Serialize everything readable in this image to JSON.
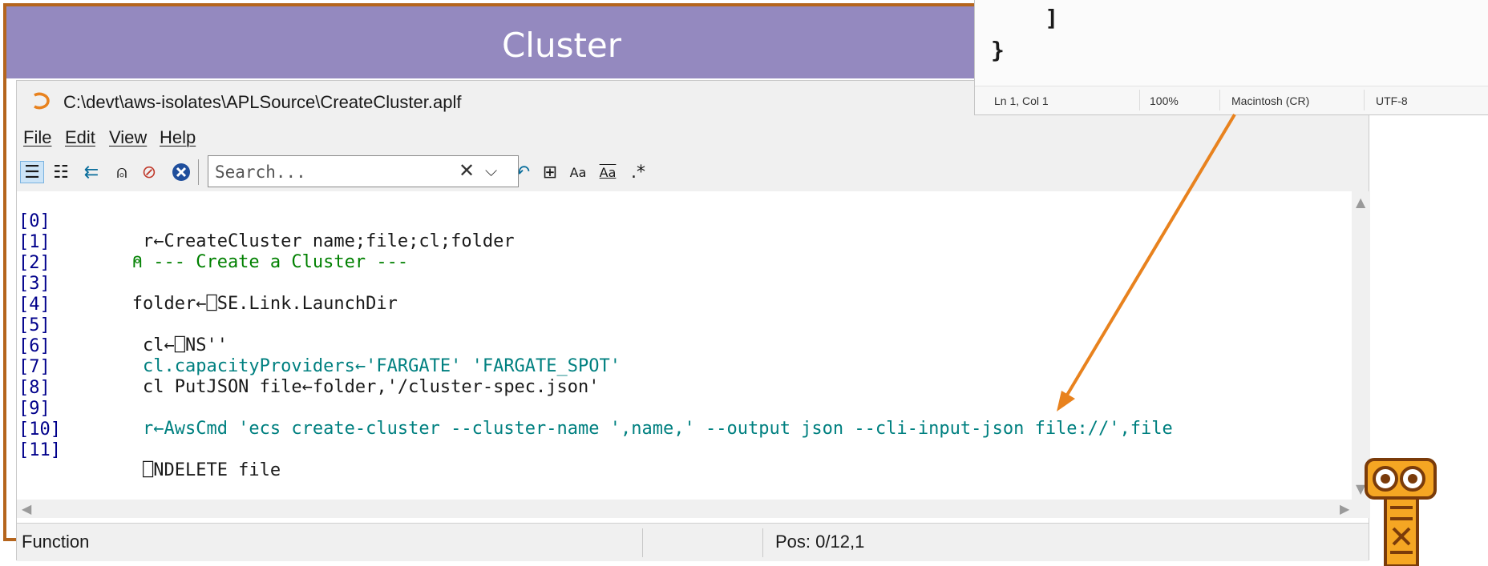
{
  "slide": {
    "title": "Cluster"
  },
  "window": {
    "title": "C:\\devt\\aws-isolates\\APLSource\\CreateCluster.aplf",
    "menu": [
      "File",
      "Edit",
      "View",
      "Help"
    ],
    "search_placeholder": "Search...",
    "clear_symbol": "✕",
    "dropdown_symbol": "⌵"
  },
  "code_lines": [
    {
      "num": "[0]",
      "text": "    r←CreateCluster name;file;cl;folder"
    },
    {
      "num": "[1]",
      "text": "   ⍝ --- Create a Cluster ---"
    },
    {
      "num": "[2]",
      "text": ""
    },
    {
      "num": "[3]",
      "text": "   folder←⎕SE.Link.LaunchDir"
    },
    {
      "num": "[4]",
      "text": ""
    },
    {
      "num": "[5]",
      "text": "    cl←⎕NS''"
    },
    {
      "num": "[6]",
      "text": "    cl.capacityProviders←'FARGATE' 'FARGATE_SPOT'"
    },
    {
      "num": "[7]",
      "text": "    cl PutJSON file←folder,'/cluster-spec.json'"
    },
    {
      "num": "[8]",
      "text": ""
    },
    {
      "num": "[9]",
      "text": "    r←AwsCmd 'ecs create-cluster --cluster-name ',name,' --output json --cli-input-json file://',file"
    },
    {
      "num": "[10]",
      "text": ""
    },
    {
      "num": "[11]",
      "text": "    ⎕NDELETE file"
    }
  ],
  "status": {
    "left": "Function",
    "pos": "Pos: 0/12,1"
  },
  "notepad": {
    "lines": [
      "    ]",
      "}"
    ],
    "status": [
      "Ln 1, Col 1",
      "100%",
      "Macintosh (CR)",
      "UTF-8"
    ]
  },
  "colors": {
    "header": "#9489bf",
    "frame": "#b5651d",
    "arrow": "#e8821e",
    "line_numbers": "#00008b",
    "comment": "#008000",
    "string": "#008080"
  }
}
